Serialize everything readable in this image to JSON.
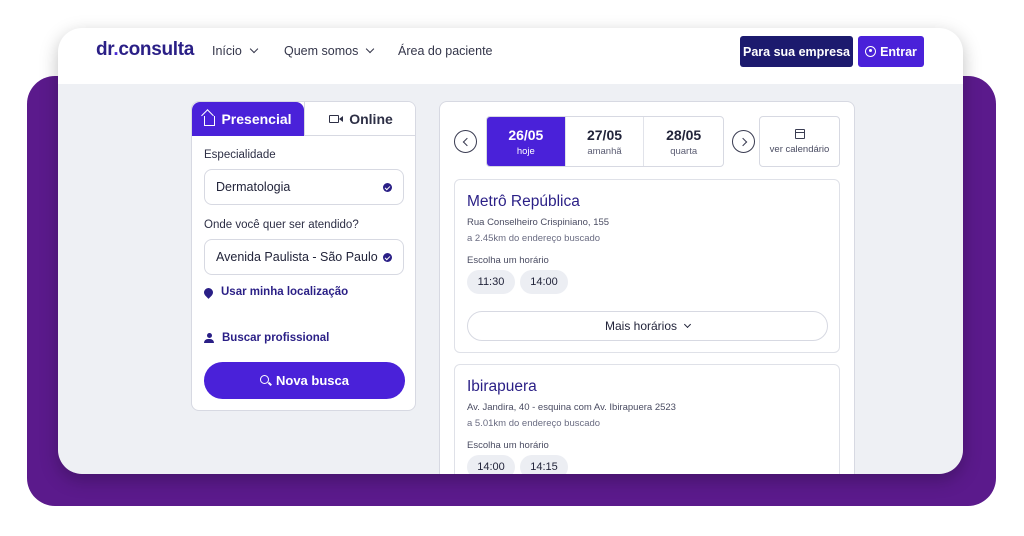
{
  "brand": {
    "logo_left": "dr",
    "logo_dot": ".",
    "logo_right": "consulta"
  },
  "nav": {
    "items": [
      {
        "label": "Início",
        "has_dropdown": true
      },
      {
        "label": "Quem somos",
        "has_dropdown": true
      },
      {
        "label": "Área do paciente",
        "has_dropdown": false
      }
    ],
    "empresa_label": "Para sua empresa",
    "entrar_label": "Entrar"
  },
  "search": {
    "tabs": [
      {
        "label": "Presencial",
        "icon": "home-icon",
        "active": true
      },
      {
        "label": "Online",
        "icon": "video-icon",
        "active": false
      }
    ],
    "especialidade_label": "Especialidade",
    "especialidade_value": "Dermatologia",
    "local_label": "Onde você quer ser atendido?",
    "local_value": "Avenida Paulista - São Paulo -",
    "use_location_label": "Usar minha localização",
    "buscar_profissional_label": "Buscar profissional",
    "nova_busca_label": "Nova busca"
  },
  "schedule": {
    "dates": [
      {
        "date": "26/05",
        "sub": "hoje",
        "active": true
      },
      {
        "date": "27/05",
        "sub": "amanhã",
        "active": false
      },
      {
        "date": "28/05",
        "sub": "quarta",
        "active": false
      }
    ],
    "calendar_label": "ver calendário",
    "locations": [
      {
        "name": "Metrô República",
        "address": "Rua Conselheiro Crispiniano, 155",
        "distance": "a 2.45km do endereço buscado",
        "choose_label": "Escolha um horário",
        "slots": [
          "11:30",
          "14:00"
        ],
        "more_label": "Mais horários"
      },
      {
        "name": "Ibirapuera",
        "address": "Av. Jandira, 40 - esquina com Av. Ibirapuera 2523",
        "distance": "a 5.01km do endereço buscado",
        "choose_label": "Escolha um horário",
        "slots": [
          "14:00",
          "14:15"
        ]
      }
    ]
  },
  "colors": {
    "brand_purple": "#4a21d9",
    "dark_navy": "#1c1a6e",
    "bg_purple": "#5b1a8c",
    "logo_navy": "#2a1f86"
  }
}
